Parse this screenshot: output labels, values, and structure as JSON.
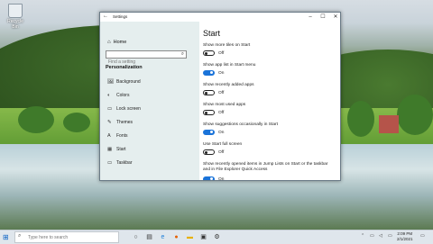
{
  "desktop": {
    "recycle_bin_label": "Recycle Bin"
  },
  "window": {
    "title": "Settings",
    "back": "←",
    "minimize": "–",
    "maximize": "☐",
    "close": "✕"
  },
  "sidebar": {
    "home": "Home",
    "search_placeholder": "Find a setting",
    "section": "Personalization",
    "items": [
      {
        "label": "Background",
        "icon": "🖼"
      },
      {
        "label": "Colors",
        "icon": "◐"
      },
      {
        "label": "Lock screen",
        "icon": "▭"
      },
      {
        "label": "Themes",
        "icon": "✎"
      },
      {
        "label": "Fonts",
        "icon": "A"
      },
      {
        "label": "Start",
        "icon": "▦"
      },
      {
        "label": "Taskbar",
        "icon": "▭"
      }
    ]
  },
  "main": {
    "page_title": "Start",
    "options": [
      {
        "label": "Show more tiles on Start",
        "state": "Off",
        "on": false
      },
      {
        "label": "Show app list in Start menu",
        "state": "On",
        "on": true
      },
      {
        "label": "Show recently added apps",
        "state": "Off",
        "on": false
      },
      {
        "label": "Show most used apps",
        "state": "Off",
        "on": false
      },
      {
        "label": "Show suggestions occasionally in Start",
        "state": "On",
        "on": true
      },
      {
        "label": "Use Start full screen",
        "state": "Off",
        "on": false
      },
      {
        "label": "Show recently opened items in Jump Lists on Start or the taskbar and in File Explorer Quick Access",
        "state": "On",
        "on": true
      }
    ]
  },
  "taskbar": {
    "search_placeholder": "Type here to search",
    "clock_time": "2:09 PM",
    "clock_date": "2/1/2021"
  },
  "colors": {
    "accent": "#1a73d9",
    "toggle_off": "#222222"
  }
}
